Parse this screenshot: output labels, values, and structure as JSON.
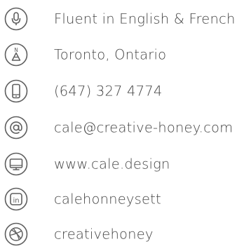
{
  "colors": {
    "icon_stroke": "#5f5f5f",
    "text": "#444444",
    "background": "#ffffff"
  },
  "contact_list": [
    {
      "icon": "microphone-icon",
      "label": "Fluent in English & French"
    },
    {
      "icon": "compass-icon",
      "label": "Toronto, Ontario",
      "icon_text": "N"
    },
    {
      "icon": "phone-icon",
      "label": "(647) 327 4774"
    },
    {
      "icon": "at-sign-icon",
      "label": "cale@creative-honey.com"
    },
    {
      "icon": "monitor-icon",
      "label": "www.cale.design"
    },
    {
      "icon": "linkedin-icon",
      "label": "calehonneysett",
      "icon_text": "in"
    },
    {
      "icon": "dribbble-icon",
      "label": "creativehoney"
    }
  ]
}
